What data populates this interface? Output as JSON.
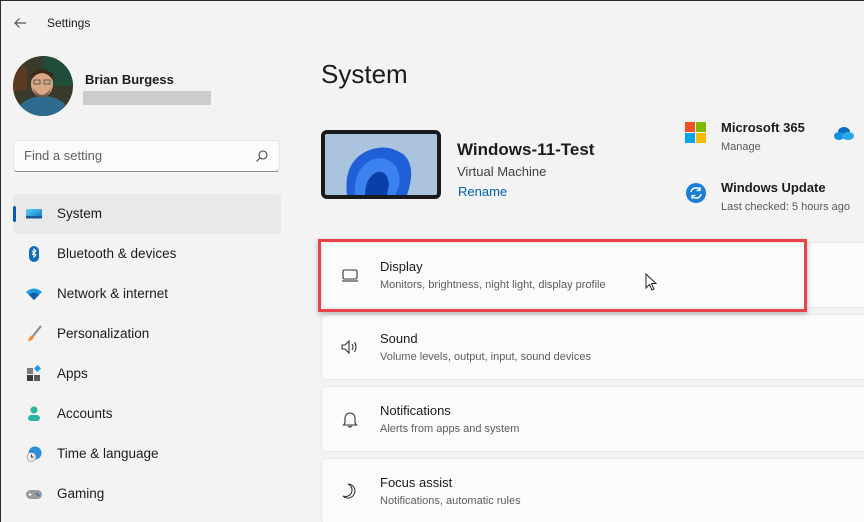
{
  "titlebar": {
    "back_icon": "arrow-left-icon",
    "title": "Settings"
  },
  "profile": {
    "name": "Brian Burgess",
    "email": "(redacted)"
  },
  "search": {
    "placeholder": "Find a setting",
    "value": "",
    "icon": "search-icon"
  },
  "sidebar": {
    "items": [
      {
        "label": "System",
        "icon": "system-display-icon",
        "active": true
      },
      {
        "label": "Bluetooth & devices",
        "icon": "bluetooth-icon",
        "active": false
      },
      {
        "label": "Network & internet",
        "icon": "wifi-icon",
        "active": false
      },
      {
        "label": "Personalization",
        "icon": "paintbrush-icon",
        "active": false
      },
      {
        "label": "Apps",
        "icon": "apps-icon",
        "active": false
      },
      {
        "label": "Accounts",
        "icon": "person-icon",
        "active": false
      },
      {
        "label": "Time & language",
        "icon": "globe-clock-icon",
        "active": false
      },
      {
        "label": "Gaming",
        "icon": "gamepad-icon",
        "active": false
      }
    ],
    "accent_color": "#005fb8"
  },
  "main": {
    "title": "System",
    "device": {
      "name": "Windows-11-Test",
      "type": "Virtual Machine",
      "rename_label": "Rename"
    },
    "quick_links": [
      {
        "title": "Microsoft 365",
        "subtitle": "Manage",
        "icon": "microsoft-logo-icon"
      },
      {
        "title": "Windows Update",
        "subtitle": "Last checked: 5 hours ago",
        "icon": "windows-update-icon"
      }
    ],
    "onedrive_icon": "onedrive-cloud-icon",
    "settings": [
      {
        "title": "Display",
        "subtitle": "Monitors, brightness, night light, display profile",
        "icon": "display-icon",
        "highlighted": true
      },
      {
        "title": "Sound",
        "subtitle": "Volume levels, output, input, sound devices",
        "icon": "speaker-icon",
        "highlighted": false
      },
      {
        "title": "Notifications",
        "subtitle": "Alerts from apps and system",
        "icon": "bell-icon",
        "highlighted": false
      },
      {
        "title": "Focus assist",
        "subtitle": "Notifications, automatic rules",
        "icon": "moon-icon",
        "highlighted": false
      }
    ],
    "highlight_color": "#e8434a"
  }
}
